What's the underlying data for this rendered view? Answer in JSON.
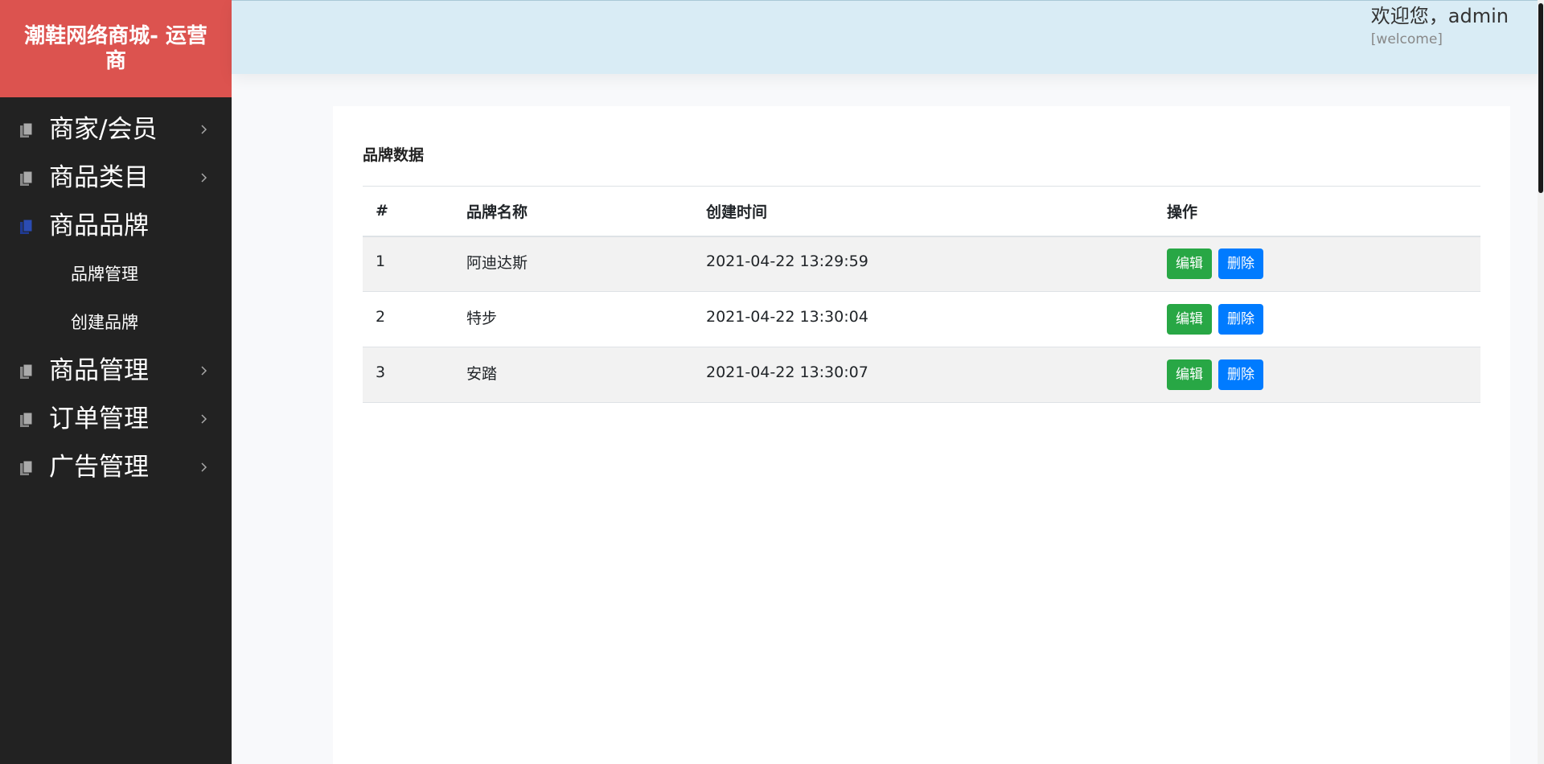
{
  "app": {
    "title": "潮鞋网络商城- 运营商"
  },
  "sidebar": {
    "items": [
      {
        "label": "商家/会员",
        "active": false
      },
      {
        "label": "商品类目",
        "active": false
      },
      {
        "label": "商品品牌",
        "active": true
      },
      {
        "label": "商品管理",
        "active": false
      },
      {
        "label": "订单管理",
        "active": false
      },
      {
        "label": "广告管理",
        "active": false
      }
    ],
    "submenu": [
      "品牌管理",
      "创建品牌"
    ]
  },
  "header": {
    "greeting": "欢迎您，admin",
    "welcome": "[welcome]"
  },
  "main": {
    "section_title": "品牌数据",
    "columns": [
      "#",
      "品牌名称",
      "创建时间",
      "操作"
    ],
    "rows": [
      {
        "id": "1",
        "name": "阿迪达斯",
        "created": "2021-04-22 13:29:59"
      },
      {
        "id": "2",
        "name": "特步",
        "created": "2021-04-22 13:30:04"
      },
      {
        "id": "3",
        "name": "安踏",
        "created": "2021-04-22 13:30:07"
      }
    ],
    "edit_label": "编辑",
    "delete_label": "删除"
  },
  "icons": {
    "menu": "document-icon",
    "expand": "chevron-right-icon"
  },
  "colors": {
    "brand": "#dc534f",
    "sidebar_bg": "#222222",
    "header_bg": "#d9ecf5",
    "active_icon": "#1f3a93",
    "edit_btn": "#28a745",
    "delete_btn": "#007bff"
  }
}
